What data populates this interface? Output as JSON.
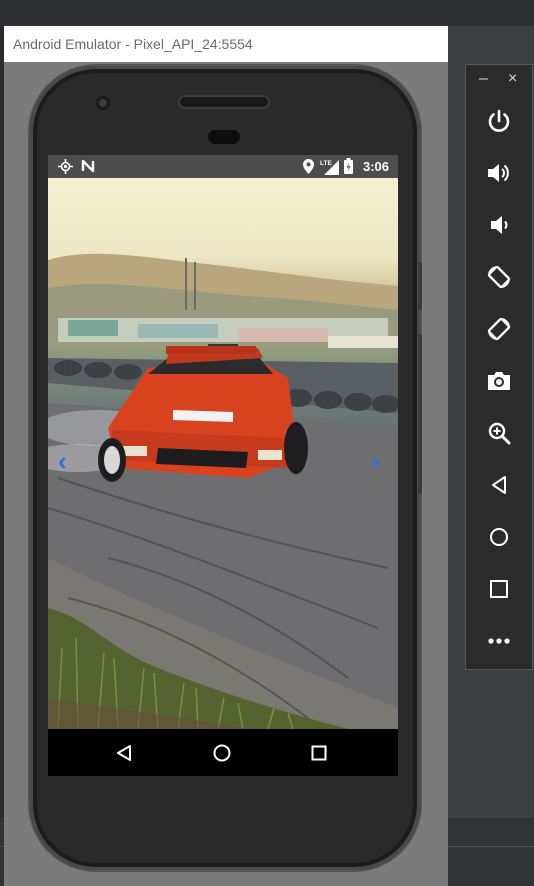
{
  "emulator": {
    "title": "Android Emulator - Pixel_API_24:5554"
  },
  "statusbar": {
    "time": "3:06",
    "network": "LTE",
    "icons": [
      "gps-icon",
      "nfc-icon",
      "location-pin-icon",
      "cellular-signal-icon",
      "battery-icon"
    ]
  },
  "photo": {
    "subject": "rally car drifting on track"
  },
  "carousel": {
    "prev_glyph": "‹",
    "next_glyph": "›"
  },
  "navbar": {
    "buttons": [
      "back-icon",
      "home-icon",
      "recents-icon"
    ]
  },
  "toolbar": {
    "minimize_glyph": "–",
    "close_glyph": "×",
    "buttons": [
      "power-icon",
      "volume-up-icon",
      "volume-down-icon",
      "rotate-left-icon",
      "rotate-right-icon",
      "camera-icon",
      "zoom-icon",
      "back-icon",
      "home-icon",
      "overview-icon",
      "more-icon"
    ]
  },
  "colors": {
    "arrow": "#2e6fd8",
    "statusbar_bg": "#4d4d4d",
    "toolbar_bg": "#2b2b2b"
  }
}
